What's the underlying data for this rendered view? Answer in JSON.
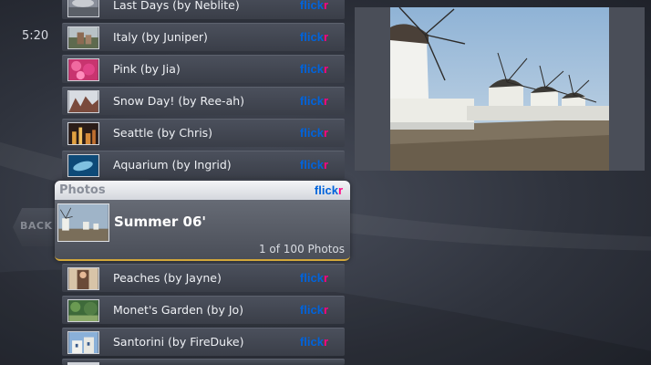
{
  "clock": "5:20",
  "back_label": "BACK",
  "brand": {
    "part1": "flick",
    "part2": "r"
  },
  "list_above": [
    {
      "title": "Last Days (by Neblite)",
      "thumb": "cloud"
    },
    {
      "title": "Italy (by Juniper)",
      "thumb": "italy"
    },
    {
      "title": "Pink (by Jia)",
      "thumb": "pink"
    },
    {
      "title": "Snow Day! (by Ree-ah)",
      "thumb": "snow"
    },
    {
      "title": "Seattle (by Chris)",
      "thumb": "seattle"
    },
    {
      "title": "Aquarium (by Ingrid)",
      "thumb": "aquarium"
    }
  ],
  "selected": {
    "header": "Photos",
    "title": "Summer 06'",
    "count": "1 of 100 Photos"
  },
  "list_below": [
    {
      "title": "Peaches (by Jayne)",
      "thumb": "peaches"
    },
    {
      "title": "Monet's Garden (by Jo)",
      "thumb": "garden"
    },
    {
      "title": "Santorini (by FireDuke)",
      "thumb": "santorini"
    }
  ],
  "colors": {
    "flickr_blue": "#0063dc",
    "flickr_pink": "#ff0084",
    "selection_accent": "#d2a73a"
  }
}
